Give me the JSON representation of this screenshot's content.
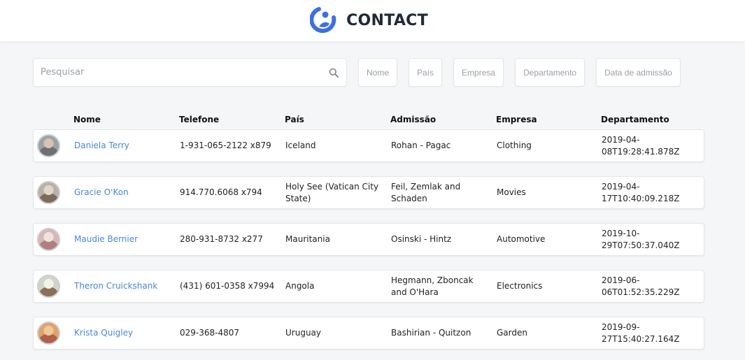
{
  "header": {
    "title": "CONTACT",
    "logo_icon": "contact-logo-icon",
    "logo_color": "#3d6fe0"
  },
  "search": {
    "placeholder": "Pesquisar",
    "value": "",
    "icon": "search-icon"
  },
  "filters": [
    "Nome",
    "País",
    "Empresa",
    "Departamento",
    "Data de admissão"
  ],
  "table": {
    "columns": [
      "Nome",
      "Telefone",
      "País",
      "Admissão",
      "Empresa",
      "Departamento"
    ],
    "rows": [
      {
        "name": "Daniela Terry",
        "phone": "1-931-065-2122 x879",
        "country": "Iceland",
        "admission": "Rohan - Pagac",
        "company": "Clothing",
        "department": "2019-04-08T19:28:41.878Z",
        "avatar_colors": [
          "#9aa3a8",
          "#6e7073",
          "#d9c2b0"
        ]
      },
      {
        "name": "Gracie O'Kon",
        "phone": "914.770.6068 x794",
        "country": "Holy See (Vatican City State)",
        "admission": "Feil, Zemlak and Schaden",
        "company": "Movies",
        "department": "2019-04-17T10:40:09.218Z",
        "avatar_colors": [
          "#b9b0a6",
          "#7d6a5d",
          "#e0d6ca"
        ]
      },
      {
        "name": "Maudie Bernier",
        "phone": "280-931-8732 x277",
        "country": "Mauritania",
        "admission": "Osinski - Hintz",
        "company": "Automotive",
        "department": "2019-10-29T07:50:37.040Z",
        "avatar_colors": [
          "#d8b7b5",
          "#b07f80",
          "#efe3e1"
        ]
      },
      {
        "name": "Theron Cruickshank",
        "phone": "(431) 601-0358 x7994",
        "country": "Angola",
        "admission": "Hegmann, Zboncak and O'Hara",
        "company": "Electronics",
        "department": "2019-06-06T01:52:35.229Z",
        "avatar_colors": [
          "#cfd6c8",
          "#8a6f5a",
          "#f4f1ea"
        ]
      },
      {
        "name": "Krista Quigley",
        "phone": "029-368-4807",
        "country": "Uruguay",
        "admission": "Bashirian - Quitzon",
        "company": "Garden",
        "department": "2019-09-27T15:40:27.164Z",
        "avatar_colors": [
          "#e1a26a",
          "#b0604a",
          "#f0c79a"
        ]
      }
    ]
  },
  "colors": {
    "accent": "#4a86d9",
    "background": "#f5f6f8"
  }
}
